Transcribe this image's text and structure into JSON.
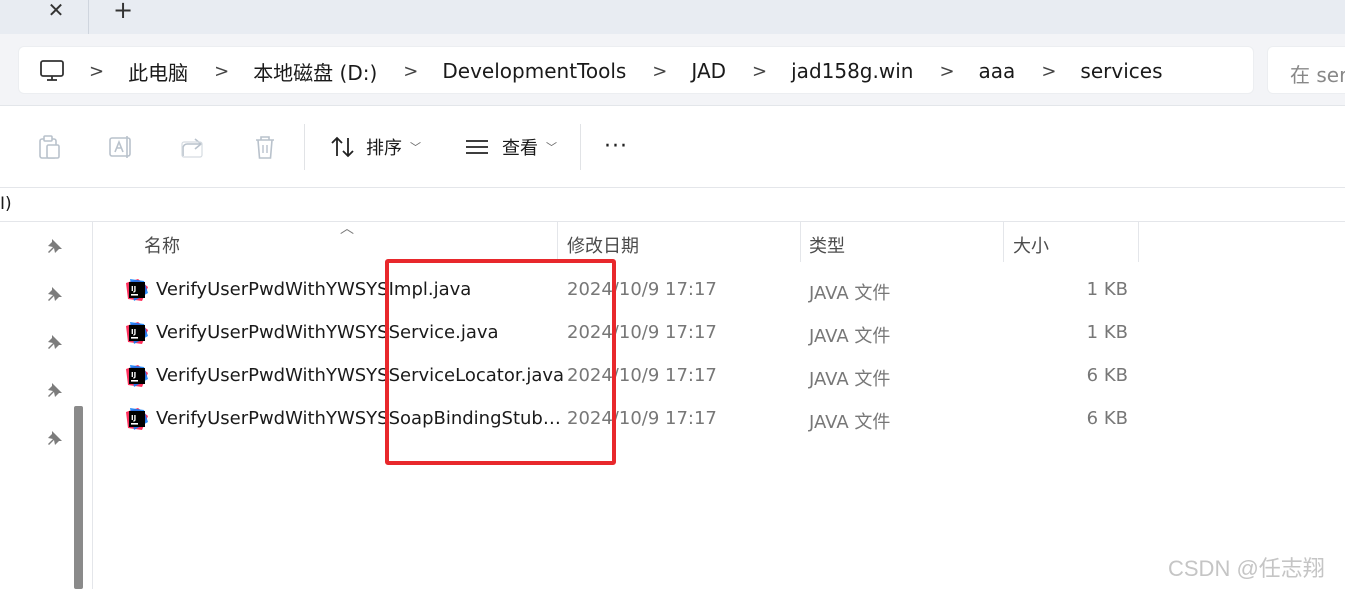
{
  "tabs": {
    "close_glyph": "✕",
    "new_tab_glyph": "+"
  },
  "address": {
    "root_icon": "pc-icon",
    "separator_glyph": ">",
    "breadcrumbs": [
      "此电脑",
      "本地磁盘 (D:)",
      "DevelopmentTools",
      "JAD",
      "jad158g.win",
      "aaa",
      "services"
    ],
    "search_placeholder": "在 ser"
  },
  "toolbar": {
    "icons": [
      "copy-icon",
      "rename-icon",
      "share-icon",
      "delete-icon"
    ],
    "sort_label": "排序",
    "view_label": "查看",
    "more_label": "···"
  },
  "clipped_text": "I)",
  "columns": {
    "name": "名称",
    "date": "修改日期",
    "type": "类型",
    "size": "大小"
  },
  "files": [
    {
      "name": "VerifyUserPwdWithYWSYSImpl.java",
      "date": "2024/10/9 17:17",
      "type": "JAVA 文件",
      "size": "1 KB"
    },
    {
      "name": "VerifyUserPwdWithYWSYSService.java",
      "date": "2024/10/9 17:17",
      "type": "JAVA 文件",
      "size": "1 KB"
    },
    {
      "name": "VerifyUserPwdWithYWSYSServiceLocator.java",
      "date": "2024/10/9 17:17",
      "type": "JAVA 文件",
      "size": "6 KB"
    },
    {
      "name": "VerifyUserPwdWithYWSYSSoapBindingStub…",
      "date": "2024/10/9 17:17",
      "type": "JAVA 文件",
      "size": "6 KB"
    }
  ],
  "colors": {
    "highlight": "#e8282c",
    "file_icon_accent": "#fe315d"
  },
  "watermark": "CSDN @任志翔"
}
